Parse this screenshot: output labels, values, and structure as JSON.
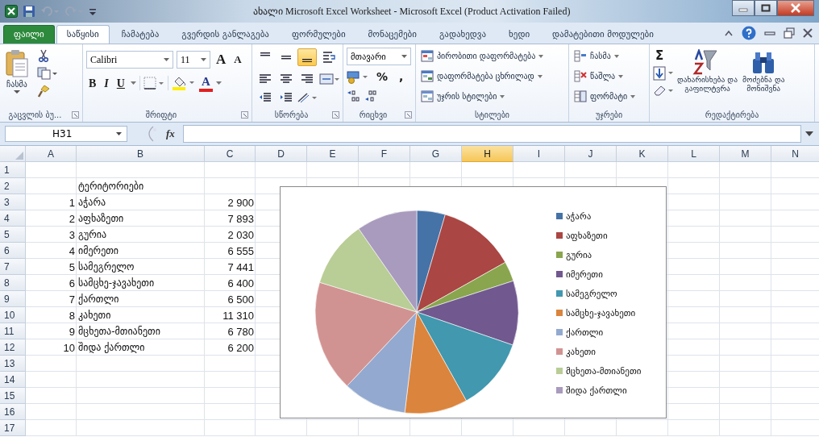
{
  "window": {
    "title": "ახალი Microsoft Excel Worksheet  -  Microsoft Excel (Product Activation Failed)"
  },
  "tabs": [
    {
      "label": "ფაილი",
      "kind": "file",
      "selected": false
    },
    {
      "label": "საწყისი",
      "kind": "tab",
      "selected": true
    },
    {
      "label": "ჩამატება",
      "kind": "tab",
      "selected": false
    },
    {
      "label": "გვერდის განლაგება",
      "kind": "tab",
      "selected": false
    },
    {
      "label": "ფორმულები",
      "kind": "tab",
      "selected": false
    },
    {
      "label": "მონაცემები",
      "kind": "tab",
      "selected": false
    },
    {
      "label": "გადახედვა",
      "kind": "tab",
      "selected": false
    },
    {
      "label": "ხედი",
      "kind": "tab",
      "selected": false
    },
    {
      "label": "დამატებითი მოდულები",
      "kind": "tab",
      "selected": false
    }
  ],
  "ribbon": {
    "clipboard": {
      "label": "გაცვლის ბუ...",
      "paste": "ჩასმა"
    },
    "font": {
      "label": "შრიფტი",
      "font_name": "Calibri",
      "font_size": "11",
      "grow": "A",
      "shrink": "A",
      "bold": "B",
      "italic": "I",
      "underline": "U",
      "font_color": "A"
    },
    "alignment": {
      "label": "სწორება",
      "buttons": [
        {
          "kind": "top",
          "selected": false
        },
        {
          "kind": "middle",
          "selected": false
        },
        {
          "kind": "bottom",
          "selected": true
        }
      ]
    },
    "number": {
      "label": "რიცხვი",
      "format": "მთავარი",
      "percent": "%",
      "comma": ","
    },
    "styles": {
      "label": "სტილები",
      "buttons": [
        "პირობითი  დაფორმატება",
        "დაფორმატება ცხრილად",
        "უჯრის სტილები"
      ]
    },
    "cells": {
      "label": "უჯრები",
      "buttons": [
        "ჩასმა",
        "წაშლა",
        "ფორმატი"
      ]
    },
    "editing": {
      "label": "რედაქტირება",
      "sum": "Σ",
      "sort": [
        "დახარისხება და",
        "გაფილტვრა"
      ],
      "find": [
        "მოძებნა და",
        "მონიშვნა"
      ]
    }
  },
  "formula_bar": {
    "name_box": "H31",
    "function_label": "fx"
  },
  "sheet": {
    "columns": [
      {
        "label": "A",
        "selected": false
      },
      {
        "label": "B",
        "selected": false
      },
      {
        "label": "C",
        "selected": false
      },
      {
        "label": "D",
        "selected": false
      },
      {
        "label": "E",
        "selected": false
      },
      {
        "label": "F",
        "selected": false
      },
      {
        "label": "G",
        "selected": false
      },
      {
        "label": "H",
        "selected": true
      },
      {
        "label": "I",
        "selected": false
      },
      {
        "label": "J",
        "selected": false
      },
      {
        "label": "K",
        "selected": false
      },
      {
        "label": "L",
        "selected": false
      },
      {
        "label": "M",
        "selected": false
      },
      {
        "label": "N",
        "selected": false
      }
    ],
    "rows": [
      {
        "number": "1"
      },
      {
        "number": "2",
        "b": "ტერიტორიები"
      },
      {
        "number": "3",
        "a": "1",
        "b": "აჭარა",
        "c": "2 900"
      },
      {
        "number": "4",
        "a": "2",
        "b": "აფხაზეთი",
        "c": "7 893"
      },
      {
        "number": "5",
        "a": "3",
        "b": "გურია",
        "c": "2 030"
      },
      {
        "number": "6",
        "a": "4",
        "b": "იმერეთი",
        "c": "6 555"
      },
      {
        "number": "7",
        "a": "5",
        "b": "სამეგრელო",
        "c": "7 441"
      },
      {
        "number": "8",
        "a": "6",
        "b": "სამცხე-ჯავახეთი",
        "c": "6 400"
      },
      {
        "number": "9",
        "a": "7",
        "b": "ქართლი",
        "c": "6 500"
      },
      {
        "number": "10",
        "a": "8",
        "b": "კახეთი",
        "c": "11 310"
      },
      {
        "number": "11",
        "a": "9",
        "b": "მცხეთა-მთიანეთი",
        "c": "6 780"
      },
      {
        "number": "12",
        "a": "10",
        "b": "შიდა ქართლი",
        "c": "6 200"
      },
      {
        "number": "13"
      },
      {
        "number": "14"
      },
      {
        "number": "15"
      },
      {
        "number": "16"
      },
      {
        "number": "17"
      }
    ]
  },
  "chart": {
    "chart_data": {
      "type": "pie",
      "legend": true,
      "categories": [
        "აჭარა",
        "აფხაზეთი",
        "გურია",
        "იმერეთი",
        "სამეგრელო",
        "სამცხე-ჯავახეთი",
        "ქართლი",
        "კახეთი",
        "მცხეთა-მთიანეთი",
        "შიდა ქართლი"
      ],
      "values": [
        4.53,
        12.33,
        3.17,
        10.24,
        11.62,
        10.0,
        10.15,
        17.68,
        10.59,
        9.69
      ]
    }
  }
}
